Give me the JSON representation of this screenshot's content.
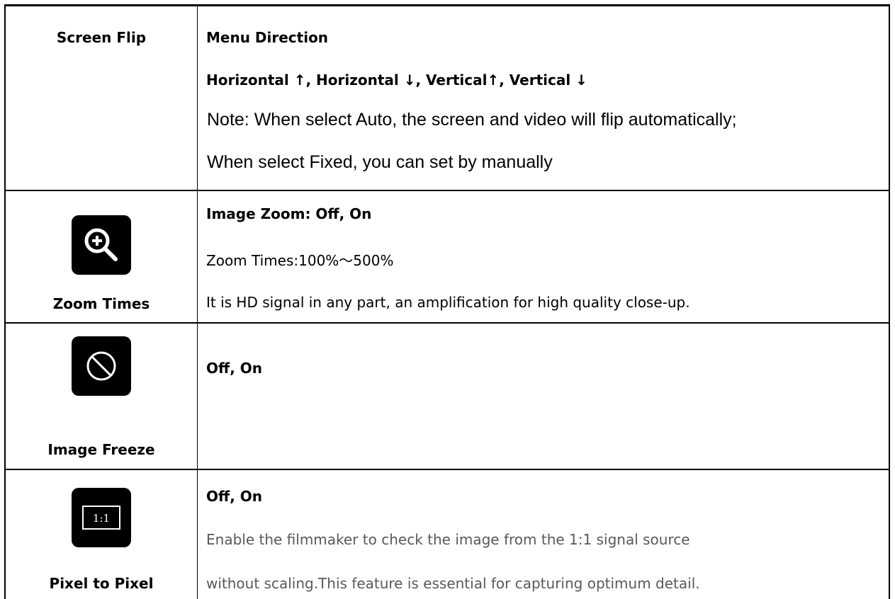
{
  "rows": [
    {
      "label": "Screen Flip",
      "lines": [
        "Menu Direction",
        "Horizontal ↑, Horizontal ↓, Vertical↑, Vertical ↓",
        "Note: When select Auto, the screen and video will flip automatically;",
        "When select Fixed, you can set by manually"
      ]
    },
    {
      "label": "Zoom Times",
      "icon": "zoom-in-icon",
      "lines": [
        "Image Zoom: Off, On",
        "Zoom Times:100%～500%",
        "It is HD signal in any part, an amplification for high quality close-up."
      ]
    },
    {
      "label": "Image Freeze",
      "icon": "freeze-icon",
      "lines": [
        "Off, On"
      ]
    },
    {
      "label": "Pixel to Pixel",
      "icon": "pixel-to-pixel-icon",
      "icon_text": "1:1",
      "lines": [
        "Off, On",
        "Enable the filmmaker to check the image from the 1:1 signal source",
        "without scaling.This feature is essential for capturing optimum detail."
      ]
    }
  ]
}
